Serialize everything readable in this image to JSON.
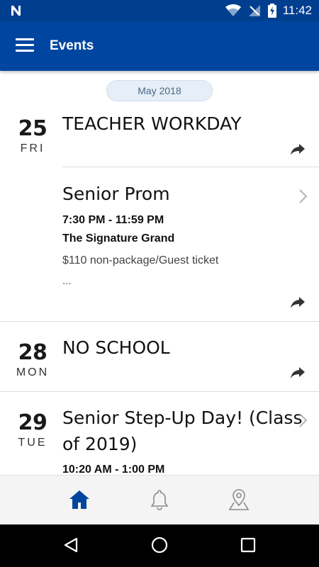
{
  "status_bar": {
    "time": "11:42",
    "icons": [
      "n-logo-icon",
      "wifi-icon",
      "signal-icon",
      "battery-charging-icon"
    ]
  },
  "app_bar": {
    "title": "Events",
    "menu_icon": "hamburger-menu-icon"
  },
  "month_label": "May 2018",
  "events": [
    {
      "day": "25",
      "dow": "FRI",
      "title": "TEACHER WORKDAY"
    },
    {
      "title": "Senior Prom",
      "time": "7:30 PM - 11:59 PM",
      "venue": "The Signature Grand",
      "description": "$110 non-package/Guest ticket",
      "ellipsis": "..."
    },
    {
      "day": "28",
      "dow": "MON",
      "title": "NO SCHOOL"
    },
    {
      "day": "29",
      "dow": "TUE",
      "title_line1": "Senior Step-Up Day! (Class",
      "title_line2": "of 2019)",
      "time": "10:20 AM - 1:00 PM"
    }
  ],
  "bottom_nav": {
    "items": [
      {
        "icon": "home-icon",
        "active": true
      },
      {
        "icon": "bell-icon",
        "active": false
      },
      {
        "icon": "map-pin-icon",
        "active": false
      }
    ],
    "active_color": "#0046a0",
    "inactive_color": "#8a8a8a"
  },
  "colors": {
    "app_bar": "#0046a0",
    "status_bar": "#003f8f"
  }
}
